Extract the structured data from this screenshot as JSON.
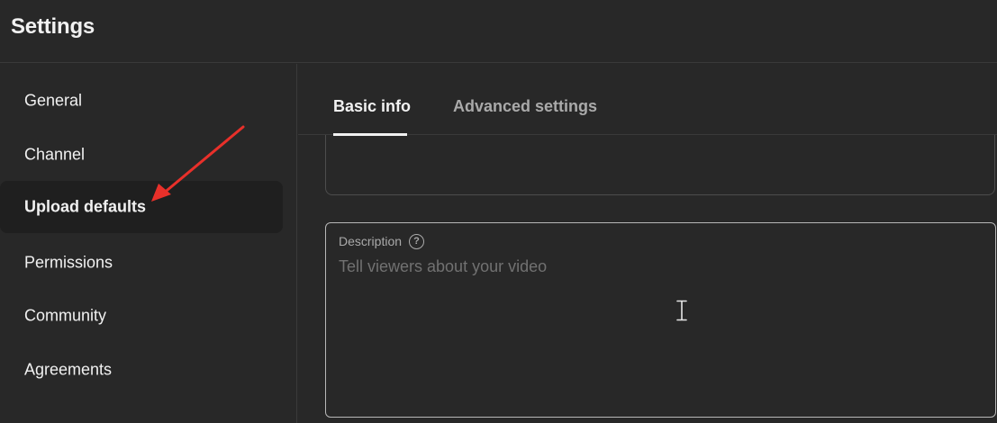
{
  "header": {
    "title": "Settings"
  },
  "sidebar": {
    "items": [
      {
        "label": "General",
        "active": false
      },
      {
        "label": "Channel",
        "active": false
      },
      {
        "label": "Upload defaults",
        "active": true
      },
      {
        "label": "Permissions",
        "active": false
      },
      {
        "label": "Community",
        "active": false
      },
      {
        "label": "Agreements",
        "active": false
      }
    ]
  },
  "tabs": [
    {
      "label": "Basic info",
      "active": true
    },
    {
      "label": "Advanced settings",
      "active": false
    }
  ],
  "description": {
    "label": "Description",
    "help_glyph": "?",
    "placeholder": "Tell viewers about your video",
    "value": ""
  },
  "colors": {
    "background": "#282828",
    "active_item_bg": "#1f1f1f",
    "annotation_arrow": "#e8302a",
    "text_primary": "#f1f1f1",
    "text_secondary": "#aaaaaa"
  },
  "icons": {
    "help": "help-circle-icon",
    "cursor": "text-cursor-icon",
    "annotation": "annotation-arrow-icon"
  }
}
